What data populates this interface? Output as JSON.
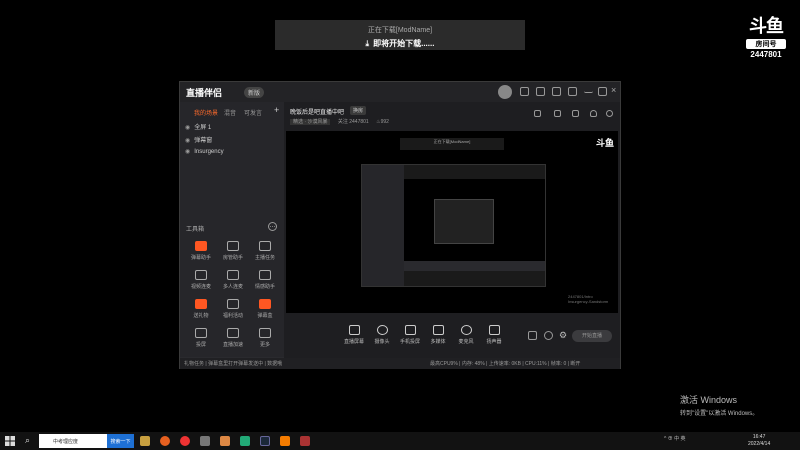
{
  "toast": {
    "line1": "正在下载[ModName]",
    "line2": "即将开始下载......"
  },
  "logo": {
    "brand": "斗鱼",
    "room_label": "房间号",
    "room_id": "2447801"
  },
  "app": {
    "brand": "直播伴侣",
    "version_badge": "新版",
    "sidebar": {
      "tabs": [
        "我的场景",
        "混音",
        "可发言"
      ],
      "add_label": "+",
      "scenes": [
        "全屏 1",
        "弹幕窗",
        "Insurgency"
      ],
      "toolbox_title": "工具箱",
      "tools": [
        {
          "label": "弹幕助手",
          "color": "orange"
        },
        {
          "label": "房管助手",
          "color": "outline"
        },
        {
          "label": "主播任务",
          "color": "outline"
        },
        {
          "label": "视频连麦",
          "color": "outline"
        },
        {
          "label": "多人连麦",
          "color": "outline"
        },
        {
          "label": "情感助手",
          "color": "outline"
        },
        {
          "label": "送礼物",
          "color": "orange"
        },
        {
          "label": "福利活动",
          "color": "outline"
        },
        {
          "label": "弹幕盒",
          "color": "orange"
        },
        {
          "label": "投屏",
          "color": "outline"
        },
        {
          "label": "直播加速",
          "color": "outline"
        },
        {
          "label": "更多",
          "color": "outline"
        }
      ]
    },
    "main": {
      "room_title": "晚饭后是吧直播中吧",
      "room_tag": "换房",
      "meta": [
        "精选 · 沙漠风暴",
        "关注 2447801",
        "992"
      ],
      "preview_toast": "正在下载[ModName]",
      "preview_logo": "斗鱼",
      "preview_info": [
        "2447801/Intro",
        "Insurgency-Sandstorm"
      ]
    },
    "controls": [
      "直播屏幕",
      "摄像头",
      "手机投屏",
      "多媒体",
      "麦克风",
      "扬声器"
    ],
    "start_button": "开始直播",
    "status_bar": {
      "notice": "礼物任务 | 弹幕盒里打开弹幕发送中 | 数据哦",
      "stats": "最高CPU9% | 内存: 48% | 上传速率: 0KB | CPU:11% | 帧率: 0 | 断开"
    }
  },
  "watermark": {
    "line1": "激活 Windows",
    "line2": "转到\"设置\"以激活 Windows。"
  },
  "taskbar": {
    "search_placeholder": "中考理应度",
    "search_button": "搜索一下",
    "time": "16:47",
    "date": "2022/4/14",
    "tray_text": "^ ⊕ 中 英"
  }
}
